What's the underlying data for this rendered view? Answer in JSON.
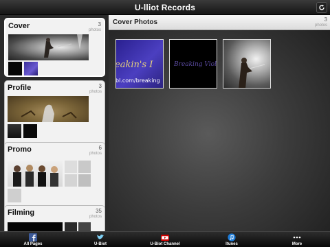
{
  "app": {
    "title": "U-lliot Records"
  },
  "sidebar": {
    "albums": [
      {
        "name": "Cover",
        "count": "3",
        "count_label": "photos"
      },
      {
        "name": "Profile",
        "count": "3",
        "count_label": "photos"
      },
      {
        "name": "Promo",
        "count": "6",
        "count_label": "photos"
      },
      {
        "name": "Filming",
        "count": "35",
        "count_label": "photos"
      }
    ]
  },
  "main": {
    "title": "Cover Photos",
    "count": "3",
    "count_label": "photos",
    "photos": [
      {
        "caption": "eakin's I",
        "subcaption": "bl.com/breaking"
      },
      {
        "caption": "Breaking Violet"
      },
      {
        "caption": ""
      }
    ]
  },
  "tabbar": {
    "tabs": [
      {
        "label": "All Pages",
        "icon": "facebook-icon"
      },
      {
        "label": "U-Biot",
        "icon": "bird-icon"
      },
      {
        "label": "U-Biot Channel",
        "icon": "youtube-icon"
      },
      {
        "label": "Itunes",
        "icon": "music-note-icon"
      },
      {
        "label": "More",
        "icon": "more-dots-icon"
      }
    ]
  },
  "colors": {
    "accent_facebook": "#3b5998",
    "accent_youtube": "#cc0000",
    "accent_itunes": "#1c7ad6"
  }
}
